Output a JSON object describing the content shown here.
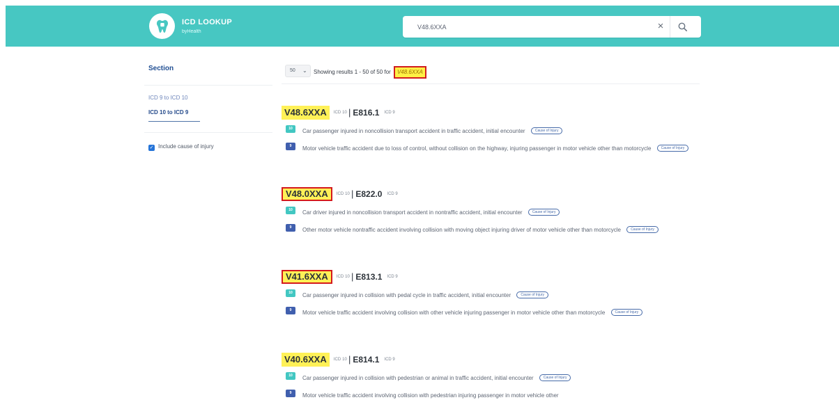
{
  "colors": {
    "header_bg": "#47c7c2",
    "highlight": "#fff157",
    "highlight_border": "#d4191d",
    "teal_badge": "#42c7c2",
    "blue_badge": "#405fae"
  },
  "header": {
    "title": "ICD LOOKUP",
    "subtitle": "byHealth"
  },
  "search": {
    "value": "V48.6XXA",
    "clear_icon": "×"
  },
  "sidebar": {
    "section_title": "Section",
    "links": [
      "ICD 9 to ICD 10",
      "ICD 10 to ICD 9"
    ],
    "include_checkbox": "✓",
    "include_label": "Include cause of injury"
  },
  "results_header": {
    "per_page": "50",
    "chevron": "⌄",
    "summary_prefix": "Showing results 1 - 50 of 50 for",
    "query": "V48.6XXA"
  },
  "results": [
    {
      "code": "V48.6XXA",
      "code_tag": "ICD 10",
      "separator": "|",
      "mapped_code": "E816.1",
      "mapped_tag": "ICD 9",
      "lines": [
        {
          "badge": "10",
          "text": "Car passenger injured in noncollision transport accident in traffic accident, initial encounter",
          "tag": "Cause of Injury"
        },
        {
          "badge": "9",
          "text": "Motor vehicle traffic accident due to loss of control, without collision on the highway, injuring passenger in motor vehicle other than motorcycle",
          "tag": "Cause of Injury"
        }
      ]
    },
    {
      "code": "V48.0XXA",
      "code_tag": "ICD 10",
      "separator": "|",
      "mapped_code": "E822.0",
      "mapped_tag": "ICD 9",
      "lines": [
        {
          "badge": "10",
          "text": "Car driver injured in noncollision transport accident in nontraffic accident, initial encounter",
          "tag": "Cause of Injury"
        },
        {
          "badge": "9",
          "text": "Other motor vehicle nontraffic accident involving collision with moving object injuring driver of motor vehicle other than motorcycle",
          "tag": "Cause of Injury"
        }
      ]
    },
    {
      "code": "V41.6XXA",
      "code_tag": "ICD 10",
      "separator": "|",
      "mapped_code": "E813.1",
      "mapped_tag": "ICD 9",
      "lines": [
        {
          "badge": "10",
          "text": "Car passenger injured in collision with pedal cycle in traffic accident, initial encounter",
          "tag": "Cause of Injury"
        },
        {
          "badge": "9",
          "text": "Motor vehicle traffic accident involving collision with other vehicle injuring passenger in motor vehicle other than motorcycle",
          "tag": "Cause of Injury"
        }
      ]
    },
    {
      "code": "V40.6XXA",
      "code_tag": "ICD 10",
      "separator": "|",
      "mapped_code": "E814.1",
      "mapped_tag": "ICD 9",
      "lines": [
        {
          "badge": "10",
          "text": "Car passenger injured in collision with pedestrian or animal in traffic accident, initial encounter",
          "tag": "Cause of Injury"
        },
        {
          "badge": "9",
          "text": "Motor vehicle traffic accident involving collision with pedestrian injuring passenger in motor vehicle other",
          "tag": ""
        }
      ]
    }
  ]
}
